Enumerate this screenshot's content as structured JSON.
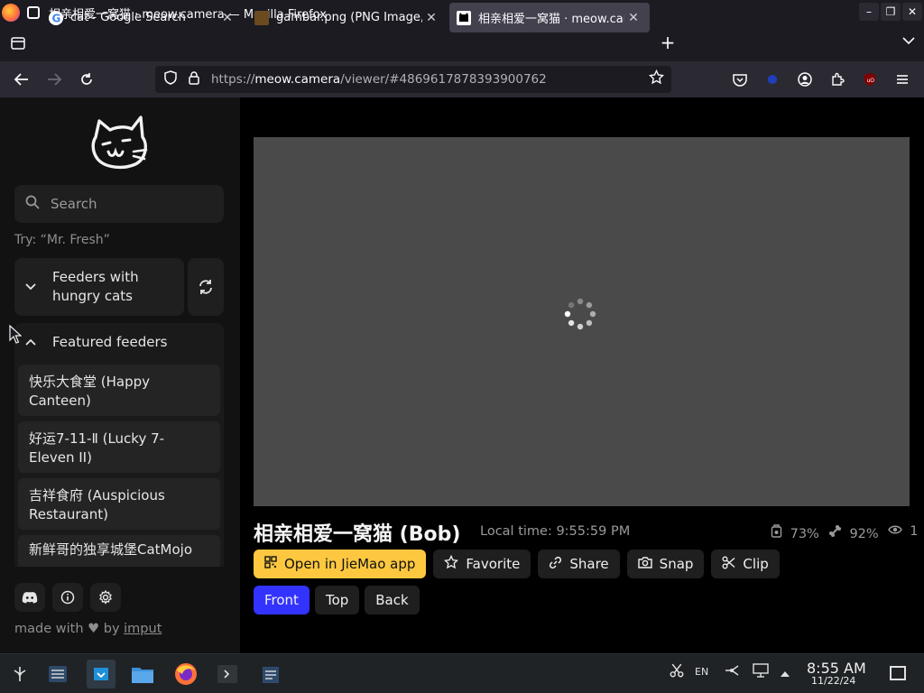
{
  "window": {
    "title": "相亲相爱一窝猫 · meow.camera — Mozilla Firefox"
  },
  "tabs": [
    {
      "label": "cat - Google Search",
      "active": false
    },
    {
      "label": "gambar.png (PNG Image, 1",
      "active": false
    },
    {
      "label": "相亲相爱一窝猫 · meow.camera",
      "active": true
    }
  ],
  "urlbar": {
    "scheme": "https://",
    "host": "meow.camera",
    "path": "/viewer/#4869617878393900762"
  },
  "sidebar": {
    "search_placeholder": "Search",
    "hint": "Try: “Mr. Fresh”",
    "group_hungry": "Feeders with hungry cats",
    "group_featured": "Featured feeders",
    "feeders": [
      "快乐大食堂 (Happy Canteen)",
      "好运7-11-Ⅱ (Lucky 7-Eleven II)",
      "吉祥食府 (Auspicious Restaurant)",
      "新鲜哥的独享城堡CatMojo"
    ],
    "made_with_prefix": "made with",
    "made_with_by": "by",
    "made_with_link": "imput"
  },
  "camera": {
    "title": "相亲相爱一窝猫 (Bob)",
    "local_time": "Local time: 9:55:59 PM",
    "stats": {
      "food": "73%",
      "battery": "92%",
      "viewers": "1"
    },
    "actions": {
      "open_app": "Open in JieMao app",
      "favorite": "Favorite",
      "share": "Share",
      "snap": "Snap",
      "clip": "Clip"
    },
    "views": [
      "Front",
      "Top",
      "Back"
    ],
    "active_view": "Front"
  },
  "taskbar": {
    "keyboard_layout": "EN",
    "time": "8:55 AM",
    "date": "11/22/24"
  },
  "colors": {
    "accent_primary": "#fdc840",
    "view_active": "#3333ff"
  }
}
